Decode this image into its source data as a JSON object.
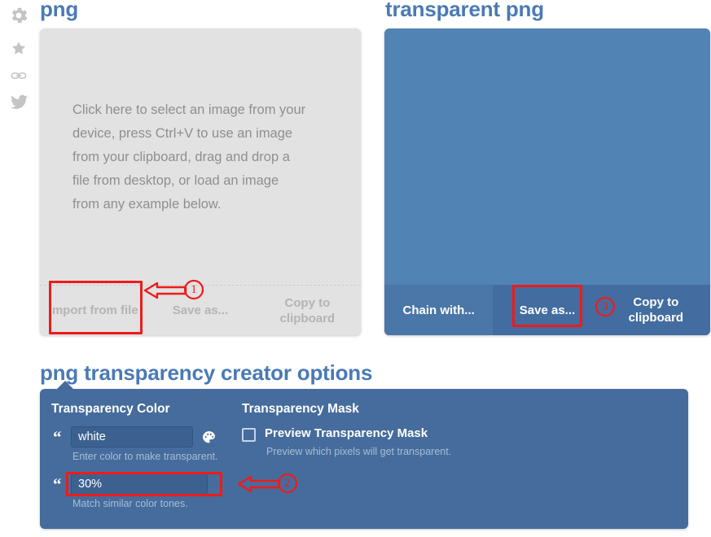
{
  "sidebar": {
    "items": [
      {
        "name": "gear-icon",
        "label": "Settings"
      },
      {
        "name": "star-icon",
        "label": "Favorite"
      },
      {
        "name": "link-icon",
        "label": "Link"
      },
      {
        "name": "twitter-icon",
        "label": "Twitter"
      }
    ]
  },
  "colors": {
    "heading": "#4a7ab5",
    "panel_blue": "#5283b5",
    "toolbar_blue": "#436da0",
    "options_blue": "#456c9c",
    "input_blue": "#3c6190",
    "panel_gray": "#e2e2e2",
    "annotation_red": "#ee1b1b",
    "muted_text": "#8f8f8f"
  },
  "input_panel": {
    "title": "png",
    "drop_text": "Click here to select an image from your device, press Ctrl+V to use an image from your clipboard, drag and drop a file from desktop, or load an image from any example below.",
    "buttons": [
      {
        "name": "import-from-file-button",
        "label": "Import from file"
      },
      {
        "name": "save-as-button",
        "label": "Save as..."
      },
      {
        "name": "copy-to-clipboard-button",
        "label": "Copy to clipboard"
      }
    ]
  },
  "output_panel": {
    "title": "transparent png",
    "buttons": [
      {
        "name": "chain-with-button",
        "label": "Chain with..."
      },
      {
        "name": "save-as-button",
        "label": "Save as..."
      },
      {
        "name": "copy-to-clipboard-button",
        "label": "Copy to clipboard"
      }
    ]
  },
  "options": {
    "title": "png transparency creator options",
    "transparency_color": {
      "heading": "Transparency Color",
      "color_value": "white",
      "color_placeholder": "white",
      "color_hint": "Enter color to make transparent.",
      "tolerance_value": "30%",
      "tolerance_placeholder": "30%",
      "tolerance_hint": "Match similar color tones.",
      "quote_glyph": "“",
      "palette_icon": "palette-icon"
    },
    "transparency_mask": {
      "heading": "Transparency Mask",
      "checkbox_label": "Preview Transparency Mask",
      "checkbox_checked": false,
      "checkbox_hint": "Preview which pixels will get transparent."
    }
  },
  "annotations": [
    {
      "id": "1",
      "target": "import-from-file-button"
    },
    {
      "id": "2",
      "target": "tolerance-input"
    },
    {
      "id": "3",
      "target": "output-save-as-button"
    }
  ]
}
